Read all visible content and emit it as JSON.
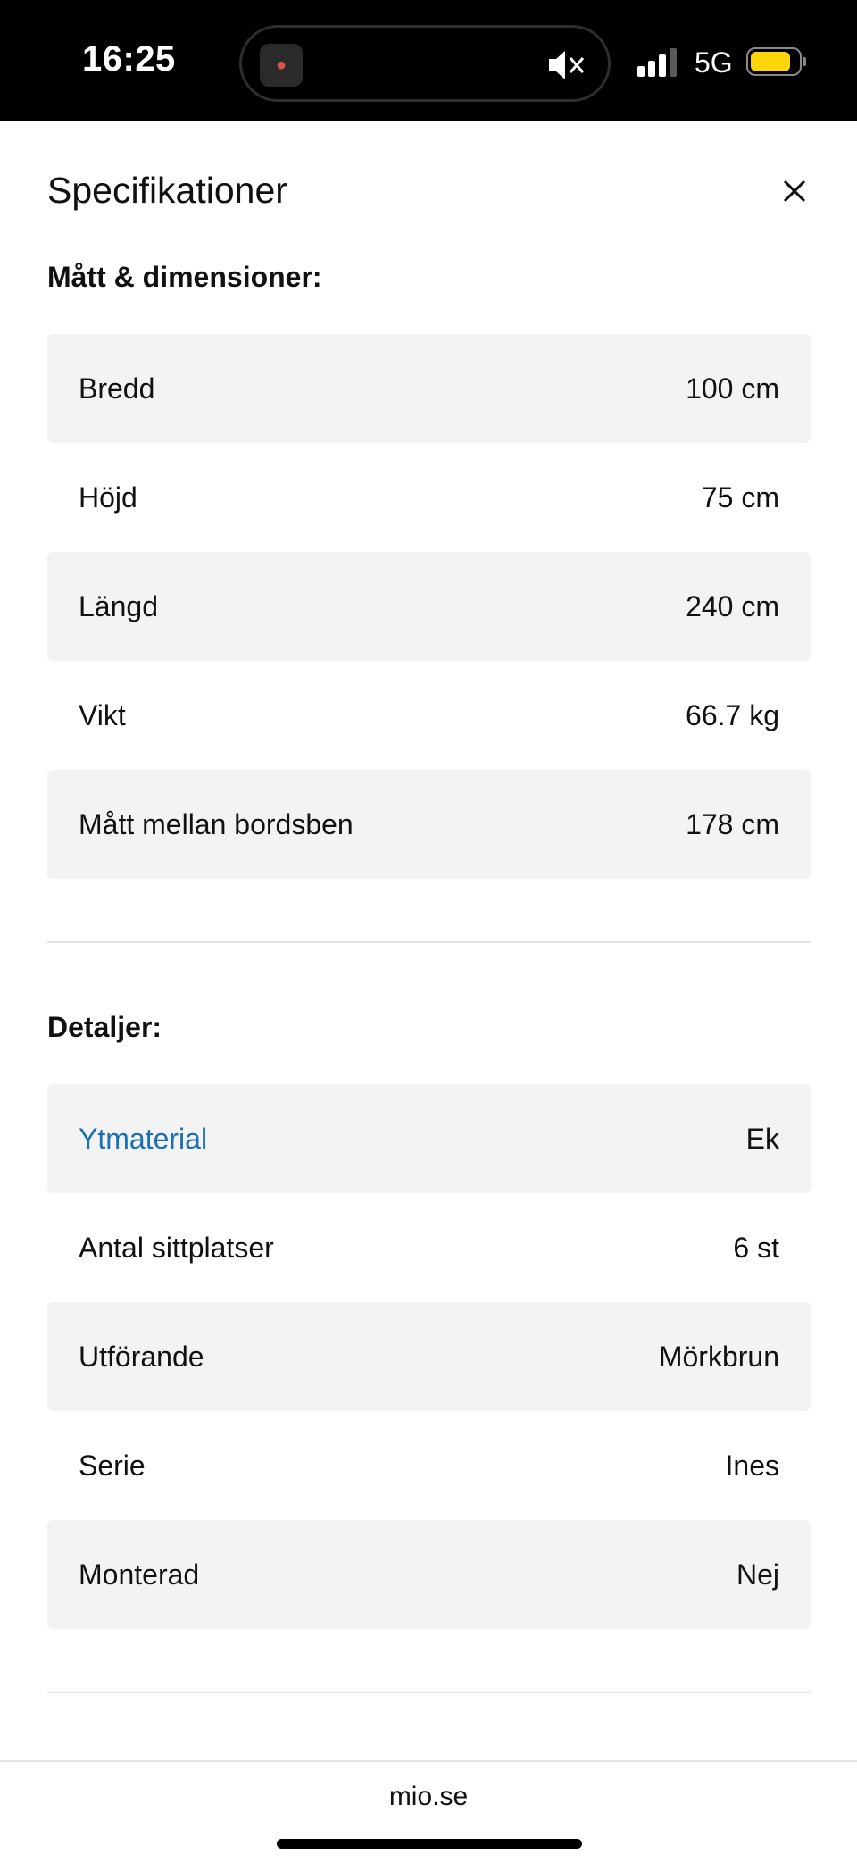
{
  "status_bar": {
    "time": "16:25",
    "network": "5G",
    "battery_color": "#FFD60A"
  },
  "sheet": {
    "title": "Specifikationer"
  },
  "dimensions": {
    "heading": "Mått & dimensioner:",
    "rows": [
      {
        "label": "Bredd",
        "value": "100 cm"
      },
      {
        "label": "Höjd",
        "value": "75 cm"
      },
      {
        "label": "Längd",
        "value": "240 cm"
      },
      {
        "label": "Vikt",
        "value": "66.7 kg"
      },
      {
        "label": "Mått mellan bordsben",
        "value": "178 cm"
      }
    ]
  },
  "details": {
    "heading": "Detaljer:",
    "rows": [
      {
        "label": "Ytmaterial",
        "value": "Ek",
        "link": true
      },
      {
        "label": "Antal sittplatser",
        "value": "6 st"
      },
      {
        "label": "Utförande",
        "value": "Mörkbrun"
      },
      {
        "label": "Serie",
        "value": "Ines"
      },
      {
        "label": "Monterad",
        "value": "Nej"
      }
    ]
  },
  "browser": {
    "url": "mio.se"
  },
  "colors": {
    "link": "#1a6fb5",
    "row_shade": "#f3f3f3"
  }
}
